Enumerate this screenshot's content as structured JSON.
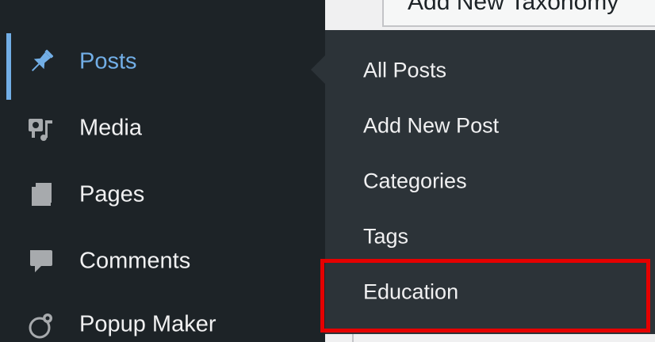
{
  "page": {
    "heading": "Add New Taxonomy"
  },
  "admin_menu": {
    "items": [
      {
        "label": "Posts",
        "icon": "pushpin-icon",
        "current": true
      },
      {
        "label": "Media",
        "icon": "media-icon",
        "current": false
      },
      {
        "label": "Pages",
        "icon": "pages-icon",
        "current": false
      },
      {
        "label": "Comments",
        "icon": "comment-bubble-icon",
        "current": false
      },
      {
        "label": "Popup Maker",
        "icon": "popup-maker-icon",
        "current": false
      }
    ]
  },
  "submenu": {
    "items": [
      {
        "label": "All Posts"
      },
      {
        "label": "Add New Post"
      },
      {
        "label": "Categories"
      },
      {
        "label": "Tags"
      },
      {
        "label": "Education",
        "highlighted": true
      }
    ]
  },
  "colors": {
    "menu_bg": "#1d2327",
    "submenu_bg": "#2c3338",
    "accent": "#72aee6",
    "highlight": "#e50000"
  }
}
